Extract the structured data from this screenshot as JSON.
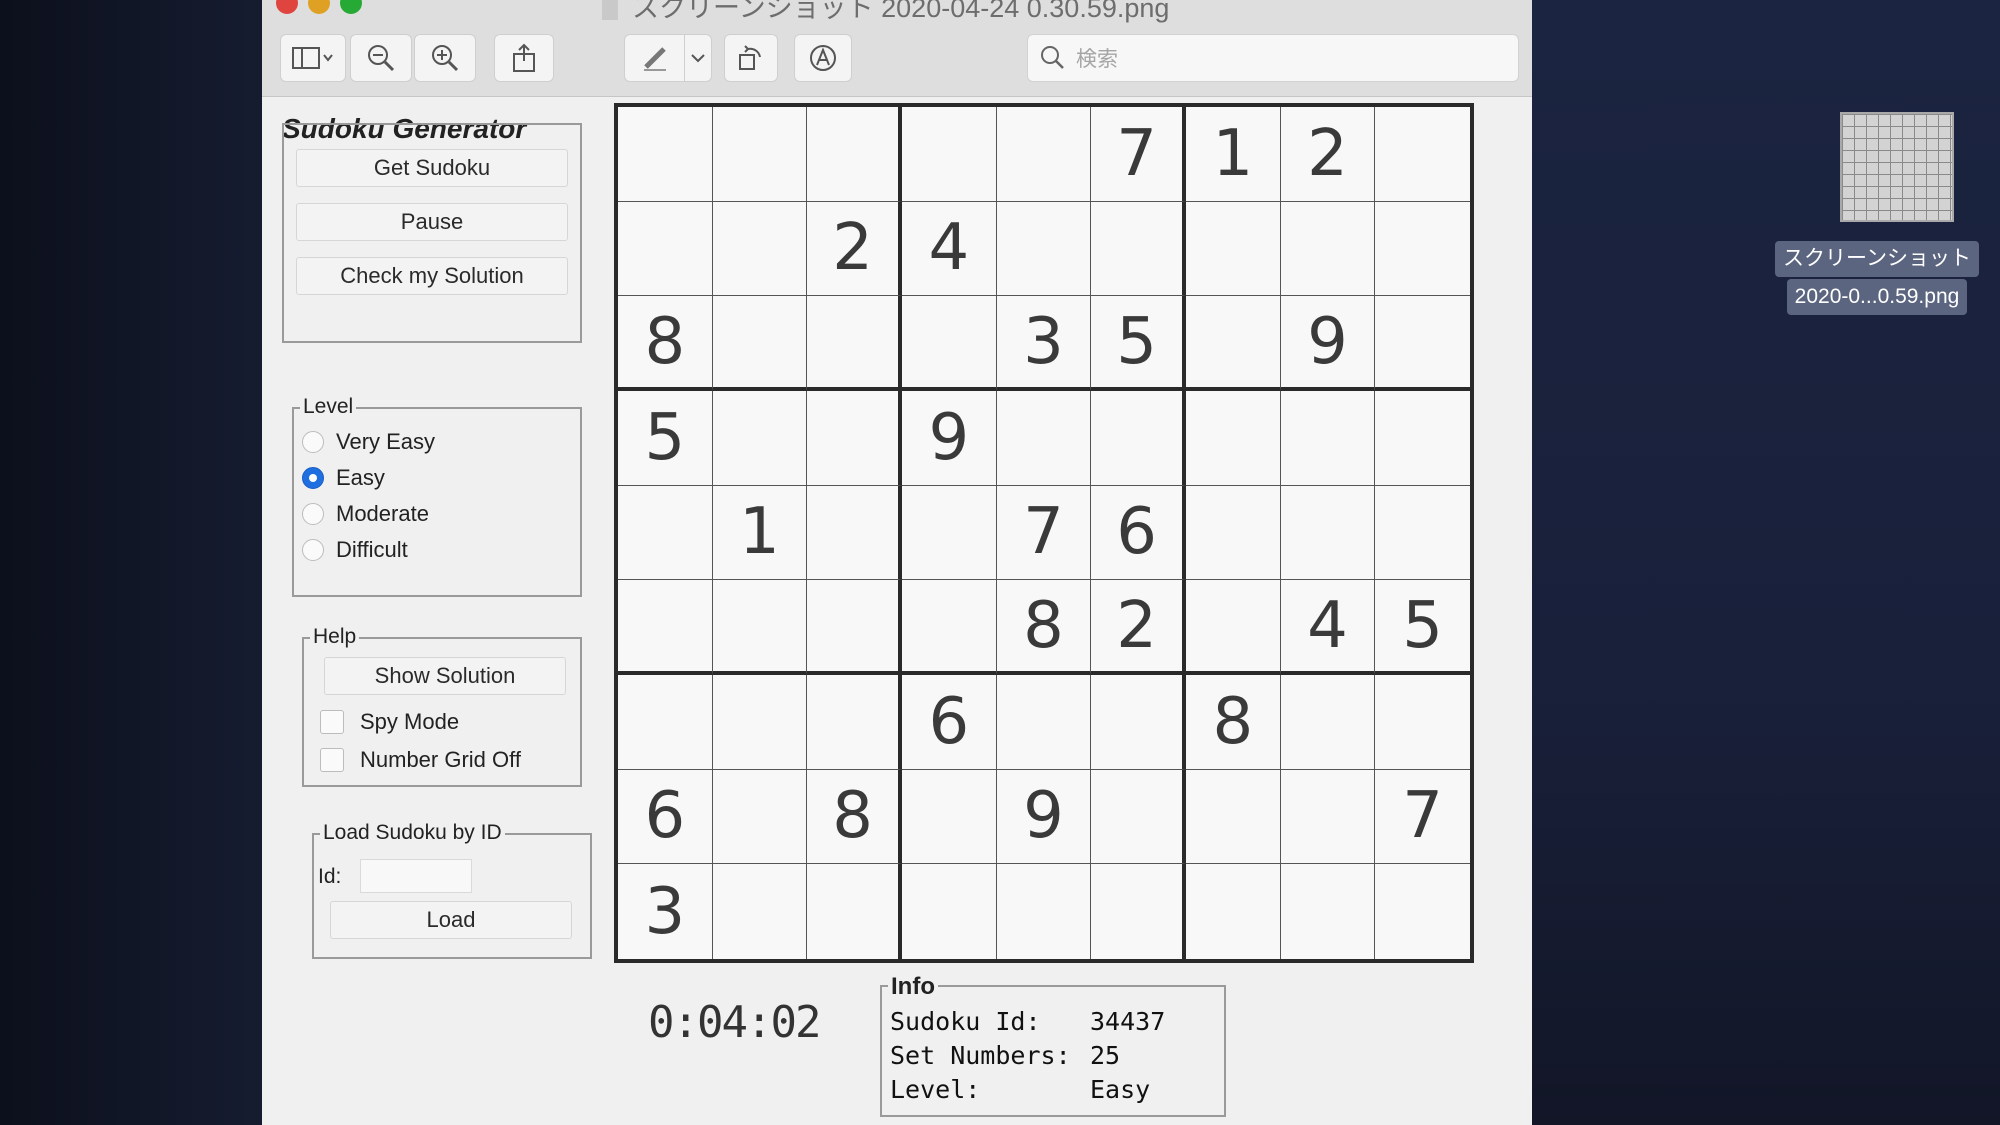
{
  "window": {
    "title": "スクリーンショット 2020-04-24 0.30.59.png",
    "search_placeholder": "検索"
  },
  "toolbar": {
    "icons": [
      "sidebar-icon",
      "zoom-out-icon",
      "zoom-in-icon",
      "share-icon",
      "markup-pen-icon",
      "chevron-down-icon",
      "rotate-icon",
      "annotate-icon",
      "search-icon"
    ]
  },
  "app": {
    "title": "Sudoku Generator",
    "buttons": {
      "get_sudoku": "Get Sudoku",
      "pause": "Pause",
      "check_solution": "Check my Solution"
    },
    "level": {
      "legend": "Level",
      "options": [
        "Very Easy",
        "Easy",
        "Moderate",
        "Difficult"
      ],
      "selected": "Easy"
    },
    "help": {
      "legend": "Help",
      "show_solution": "Show Solution",
      "spy_mode": "Spy Mode",
      "number_grid_off": "Number Grid Off"
    },
    "load": {
      "legend": "Load Sudoku by ID",
      "id_label": "Id:",
      "id_value": "",
      "load_button": "Load"
    },
    "timer": "0:04:02",
    "info": {
      "legend": "Info",
      "sudoku_id_label": "Sudoku Id:",
      "sudoku_id": "34437",
      "set_numbers_label": "Set Numbers:",
      "set_numbers": "25",
      "level_label": "Level:",
      "level": "Easy"
    }
  },
  "grid": [
    [
      "",
      "",
      "",
      "",
      "",
      "7",
      "1",
      "2",
      ""
    ],
    [
      "",
      "",
      "2",
      "4",
      "",
      "",
      "",
      "",
      ""
    ],
    [
      "8",
      "",
      "",
      "",
      "3",
      "5",
      "",
      "9",
      ""
    ],
    [
      "5",
      "",
      "",
      "9",
      "",
      "",
      "",
      "",
      ""
    ],
    [
      "",
      "1",
      "",
      "",
      "7",
      "6",
      "",
      "",
      ""
    ],
    [
      "",
      "",
      "",
      "",
      "8",
      "2",
      "",
      "4",
      "5"
    ],
    [
      "",
      "",
      "",
      "6",
      "",
      "",
      "8",
      "",
      ""
    ],
    [
      "6",
      "",
      "8",
      "",
      "9",
      "",
      "",
      "",
      "7"
    ],
    [
      "3",
      "",
      "",
      "",
      "",
      "",
      "",
      "",
      ""
    ]
  ],
  "desktop": {
    "file_label_line1": "スクリーンショット",
    "file_label_line2": "2020-0...0.59.png"
  },
  "colors": {
    "accent_radio": "#1f6fe0",
    "traffic_red": "#e0443e",
    "traffic_yellow": "#dea123",
    "traffic_green": "#27aa35"
  }
}
